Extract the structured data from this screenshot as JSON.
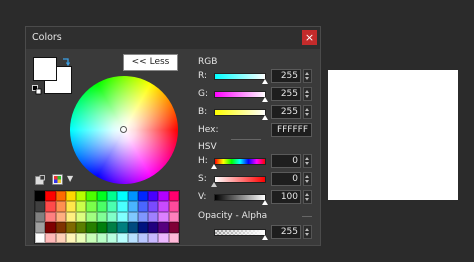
{
  "dialog": {
    "title": "Colors",
    "close_label": "×"
  },
  "less_button": "<< Less",
  "rgb": {
    "label": "RGB",
    "channels": [
      {
        "label": "R:",
        "value": "255"
      },
      {
        "label": "G:",
        "value": "255"
      },
      {
        "label": "B:",
        "value": "255"
      }
    ]
  },
  "hex": {
    "label": "Hex:",
    "value": "FFFFFF"
  },
  "hsv": {
    "label": "HSV",
    "channels": [
      {
        "label": "H:",
        "value": "0"
      },
      {
        "label": "S:",
        "value": "0"
      },
      {
        "label": "V:",
        "value": "100"
      }
    ]
  },
  "alpha": {
    "label": "Opacity - Alpha",
    "value": "255"
  },
  "colors": {
    "primary": "#ffffff",
    "secondary": "#ffffff",
    "preview": "#ffffff"
  },
  "palette": [
    "#000000",
    "#ff0000",
    "#ff6a00",
    "#ffd800",
    "#b6ff00",
    "#4cff00",
    "#00ff21",
    "#00ff90",
    "#00ffff",
    "#0094ff",
    "#0026ff",
    "#4800ff",
    "#b200ff",
    "#ff006e",
    "#404040",
    "#ff4a4a",
    "#ff9050",
    "#ffe74a",
    "#c9ff4a",
    "#7aff4a",
    "#4aff66",
    "#4affb0",
    "#4affff",
    "#4ab4ff",
    "#4a66ff",
    "#7a4aff",
    "#c94aff",
    "#ff4a9c",
    "#808080",
    "#ff8080",
    "#ffb080",
    "#fff080",
    "#dcff80",
    "#a0ff80",
    "#80ff96",
    "#80ffc8",
    "#80ffff",
    "#80c8ff",
    "#8096ff",
    "#a080ff",
    "#dc80ff",
    "#ff80bc",
    "#a0a0a0",
    "#7f0000",
    "#7f3300",
    "#7f6a00",
    "#5b7f00",
    "#267f00",
    "#007f0e",
    "#007f46",
    "#007f7f",
    "#004a7f",
    "#00137f",
    "#21007f",
    "#57007f",
    "#7f0037",
    "#ffffff",
    "#ffb8b8",
    "#ffd0b8",
    "#fff6b8",
    "#ecffb8",
    "#c8ffb8",
    "#b8ffc6",
    "#b8ffe0",
    "#b8ffff",
    "#b8e0ff",
    "#b8c6ff",
    "#c8b8ff",
    "#ecb8ff",
    "#ffb8d8"
  ]
}
